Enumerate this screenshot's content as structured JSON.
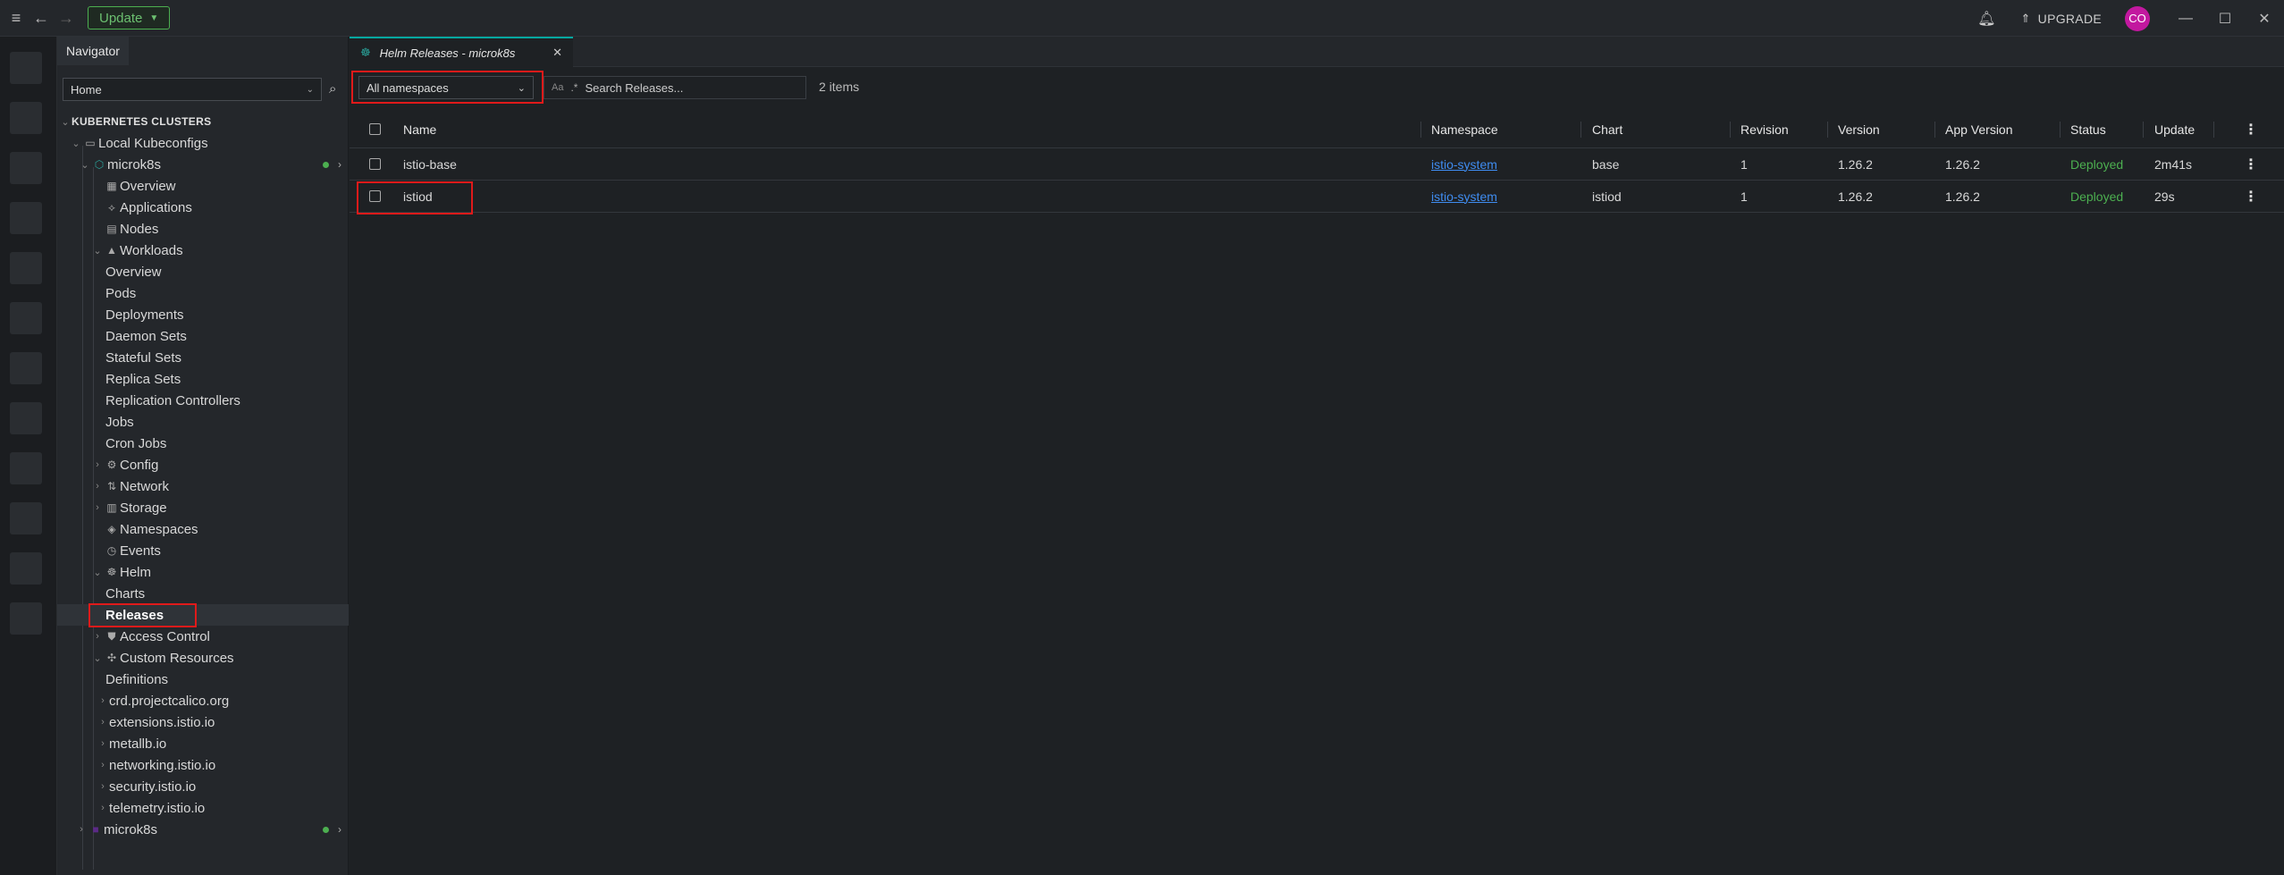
{
  "titlebar": {
    "update_label": "Update",
    "upgrade_label": "UPGRADE",
    "avatar_initials": "CO"
  },
  "sidebar": {
    "navigator_tab": "Navigator",
    "home_select": "Home",
    "section_header": "KUBERNETES CLUSTERS",
    "local_kubeconfigs": "Local Kubeconfigs",
    "cluster_name": "microk8s",
    "items": {
      "overview": "Overview",
      "applications": "Applications",
      "nodes": "Nodes",
      "workloads": "Workloads",
      "wl_overview": "Overview",
      "pods": "Pods",
      "deployments": "Deployments",
      "daemon_sets": "Daemon Sets",
      "stateful_sets": "Stateful Sets",
      "replica_sets": "Replica Sets",
      "replication_controllers": "Replication Controllers",
      "jobs": "Jobs",
      "cron_jobs": "Cron Jobs",
      "config": "Config",
      "network": "Network",
      "storage": "Storage",
      "namespaces": "Namespaces",
      "events": "Events",
      "helm": "Helm",
      "charts": "Charts",
      "releases": "Releases",
      "access_control": "Access Control",
      "custom_resources": "Custom Resources",
      "definitions": "Definitions",
      "crd_calico": "crd.projectcalico.org",
      "crd_extensions": "extensions.istio.io",
      "crd_metallb": "metallb.io",
      "crd_networking": "networking.istio.io",
      "crd_security": "security.istio.io",
      "crd_telemetry": "telemetry.istio.io"
    },
    "second_cluster": "microk8s"
  },
  "main": {
    "tab_title": "Helm Releases - microk8s",
    "namespace_select": "All namespaces",
    "search_case_label": "Aa",
    "search_regex_label": ".*",
    "search_placeholder": "Search Releases...",
    "items_count": "2 items",
    "columns": {
      "name": "Name",
      "namespace": "Namespace",
      "chart": "Chart",
      "revision": "Revision",
      "version": "Version",
      "app_version": "App Version",
      "status": "Status",
      "updated": "Update"
    },
    "rows": [
      {
        "name": "istio-base",
        "namespace": "istio-system",
        "chart": "base",
        "revision": "1",
        "version": "1.26.2",
        "app_version": "1.26.2",
        "status": "Deployed",
        "updated": "2m41s"
      },
      {
        "name": "istiod",
        "namespace": "istio-system",
        "chart": "istiod",
        "revision": "1",
        "version": "1.26.2",
        "app_version": "1.26.2",
        "status": "Deployed",
        "updated": "29s"
      }
    ]
  }
}
